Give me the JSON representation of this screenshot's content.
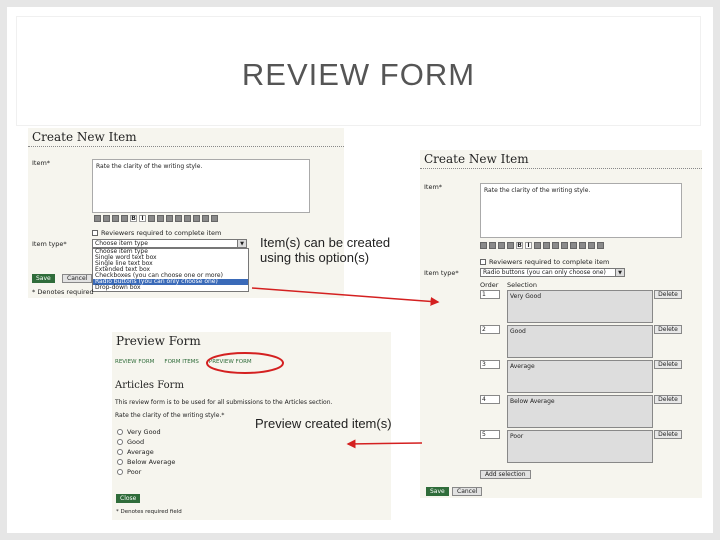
{
  "slide": {
    "title": "REVIEW FORM"
  },
  "create_left": {
    "title": "Create New Item",
    "item_label": "Item*",
    "item_text": "Rate the clarity of the writing style.",
    "checkbox_label": "Reviewers required to complete item",
    "type_label": "Item type*",
    "type_value": "Choose item type",
    "options": [
      "Choose item type",
      "Single word text box",
      "Single line text box",
      "Extended text box",
      "Checkboxes (you can choose one or more)",
      "Radio buttons (you can only choose one)",
      "Drop-down box"
    ],
    "save_label": "Save",
    "cancel_label": "Cancel",
    "required_note": "* Denotes required"
  },
  "create_right": {
    "title": "Create New Item",
    "item_label": "Item*",
    "item_text": "Rate the clarity of the writing style.",
    "checkbox_label": "Reviewers required to complete item",
    "type_label": "Item type*",
    "type_value": "Radio buttons (you can only choose one)",
    "order_header": "Order",
    "selection_header": "Selection",
    "rows": [
      {
        "order": "1",
        "selection": "Very Good",
        "delete": "Delete"
      },
      {
        "order": "2",
        "selection": "Good",
        "delete": "Delete"
      },
      {
        "order": "3",
        "selection": "Average",
        "delete": "Delete"
      },
      {
        "order": "4",
        "selection": "Below Average",
        "delete": "Delete"
      },
      {
        "order": "5",
        "selection": "Poor",
        "delete": "Delete"
      }
    ],
    "add_selection_label": "Add selection",
    "save_label": "Save",
    "cancel_label": "Cancel"
  },
  "preview": {
    "title": "Preview Form",
    "tabs": [
      "REVIEW FORM",
      "FORM ITEMS",
      "PREVIEW FORM"
    ],
    "form_title": "Articles Form",
    "form_desc": "This review form is to be used for all submissions to the Articles section.",
    "question": "Rate the clarity of the writing style.*",
    "options": [
      "Very Good",
      "Good",
      "Average",
      "Below Average",
      "Poor"
    ],
    "close_label": "Close",
    "required_note": "* Denotes required field"
  },
  "annotations": {
    "create_note_line1": "Item(s) can be created",
    "create_note_line2": "using this option(s)",
    "preview_note": "Preview created item(s)"
  },
  "colors": {
    "arrow": "#d42020",
    "green_button": "#2f6c3a",
    "highlight": "#3a6ab8"
  }
}
